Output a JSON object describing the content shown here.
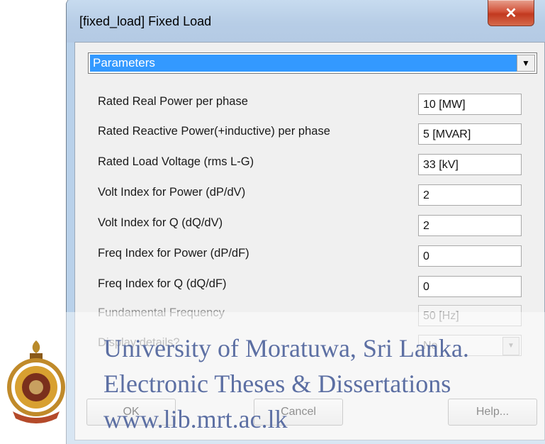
{
  "window": {
    "title": "[fixed_load] Fixed Load",
    "close_icon": "close-icon"
  },
  "section": {
    "selected": "Parameters"
  },
  "parameters": [
    {
      "label": "Rated Real Power per phase",
      "value": "10 [MW]"
    },
    {
      "label": "Rated Reactive Power(+inductive) per phase",
      "value": "5 [MVAR]"
    },
    {
      "label": "Rated Load Voltage (rms L-G)",
      "value": "33 [kV]"
    },
    {
      "label": "Volt Index for Power (dP/dV)",
      "value": "2"
    },
    {
      "label": "Volt Index for Q (dQ/dV)",
      "value": "2"
    },
    {
      "label": "Freq Index for Power (dP/dF)",
      "value": "0"
    },
    {
      "label": "Freq Index for Q (dQ/dF)",
      "value": "0"
    },
    {
      "label": "Fundamental Frequency",
      "value": "50 [Hz]"
    },
    {
      "label": "Display details?",
      "value": "No"
    }
  ],
  "buttons": {
    "ok": "OK",
    "cancel": "Cancel",
    "help": "Help..."
  },
  "watermark": {
    "line1": "University of Moratuwa, Sri Lanka.",
    "line2": "Electronic Theses & Dissertations",
    "line3": "www.lib.mrt.ac.lk"
  },
  "colors": {
    "selection": "#3399ff",
    "titlebar": "#b9d1ea",
    "close": "#c2391f",
    "watermark": "#5c6fa3"
  }
}
